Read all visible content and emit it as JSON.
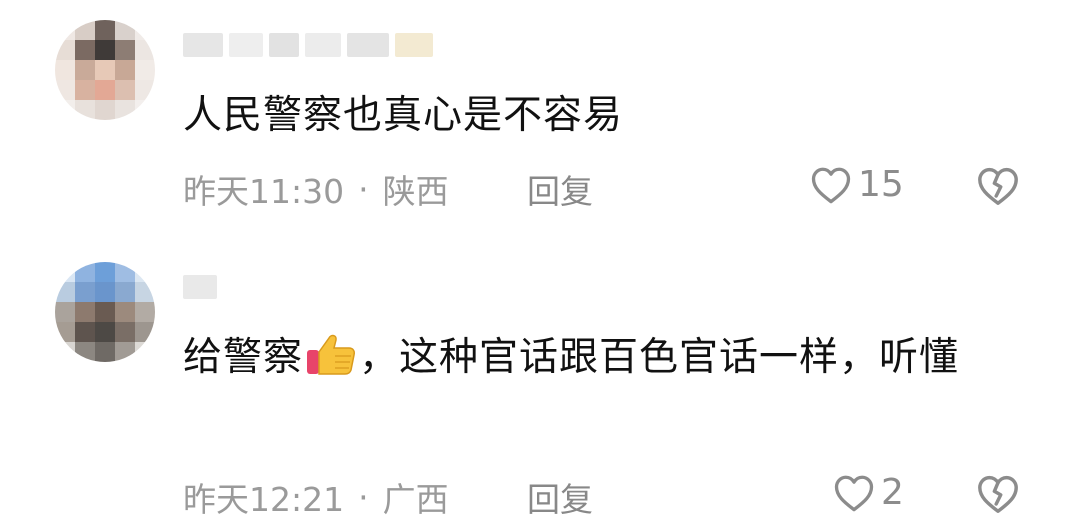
{
  "comments": [
    {
      "text": "人民警察也真心是不容易",
      "time": "昨天11:30",
      "location": "陕西",
      "reply_label": "回复",
      "likes": "15"
    },
    {
      "text_before": "给警察",
      "emoji": "thumbs-up-icon",
      "text_after": "，这种官话跟百色官话一样，听懂",
      "time": "昨天12:21",
      "location": "广西",
      "reply_label": "回复",
      "likes": "2"
    }
  ],
  "colors": {
    "meta_text": "#9a9a9a",
    "icon_stroke": "#8c8c8c"
  }
}
